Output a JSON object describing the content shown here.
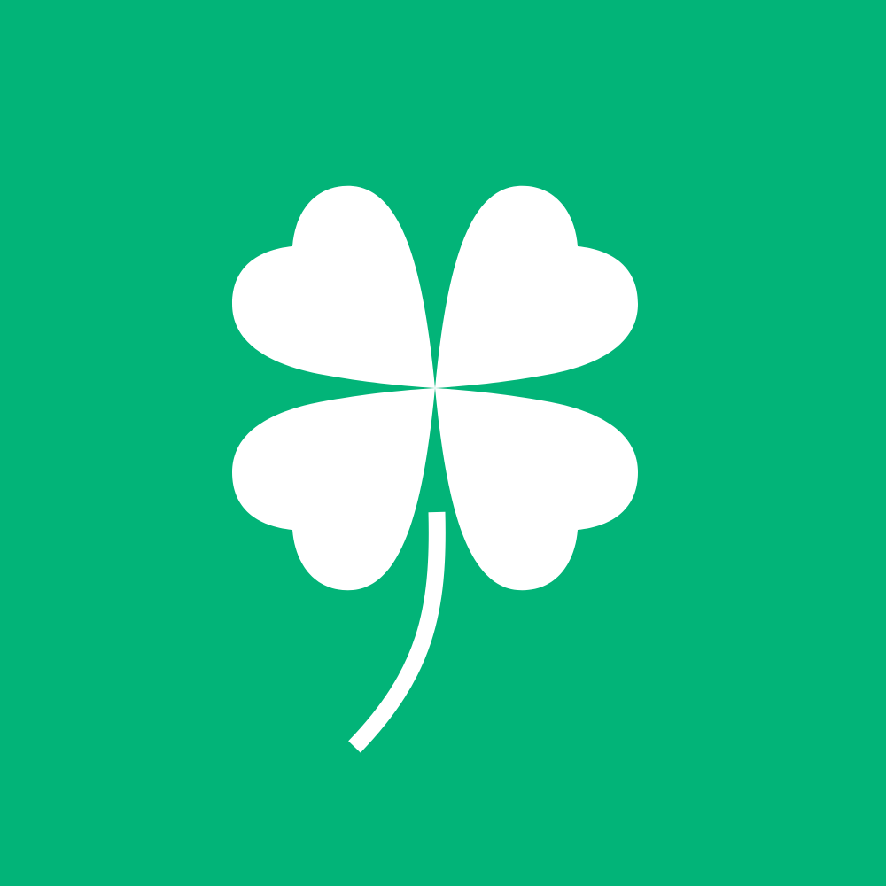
{
  "icon": {
    "name": "four-leaf-clover-icon",
    "background_color": "#02b478",
    "foreground_color": "#ffffff"
  }
}
